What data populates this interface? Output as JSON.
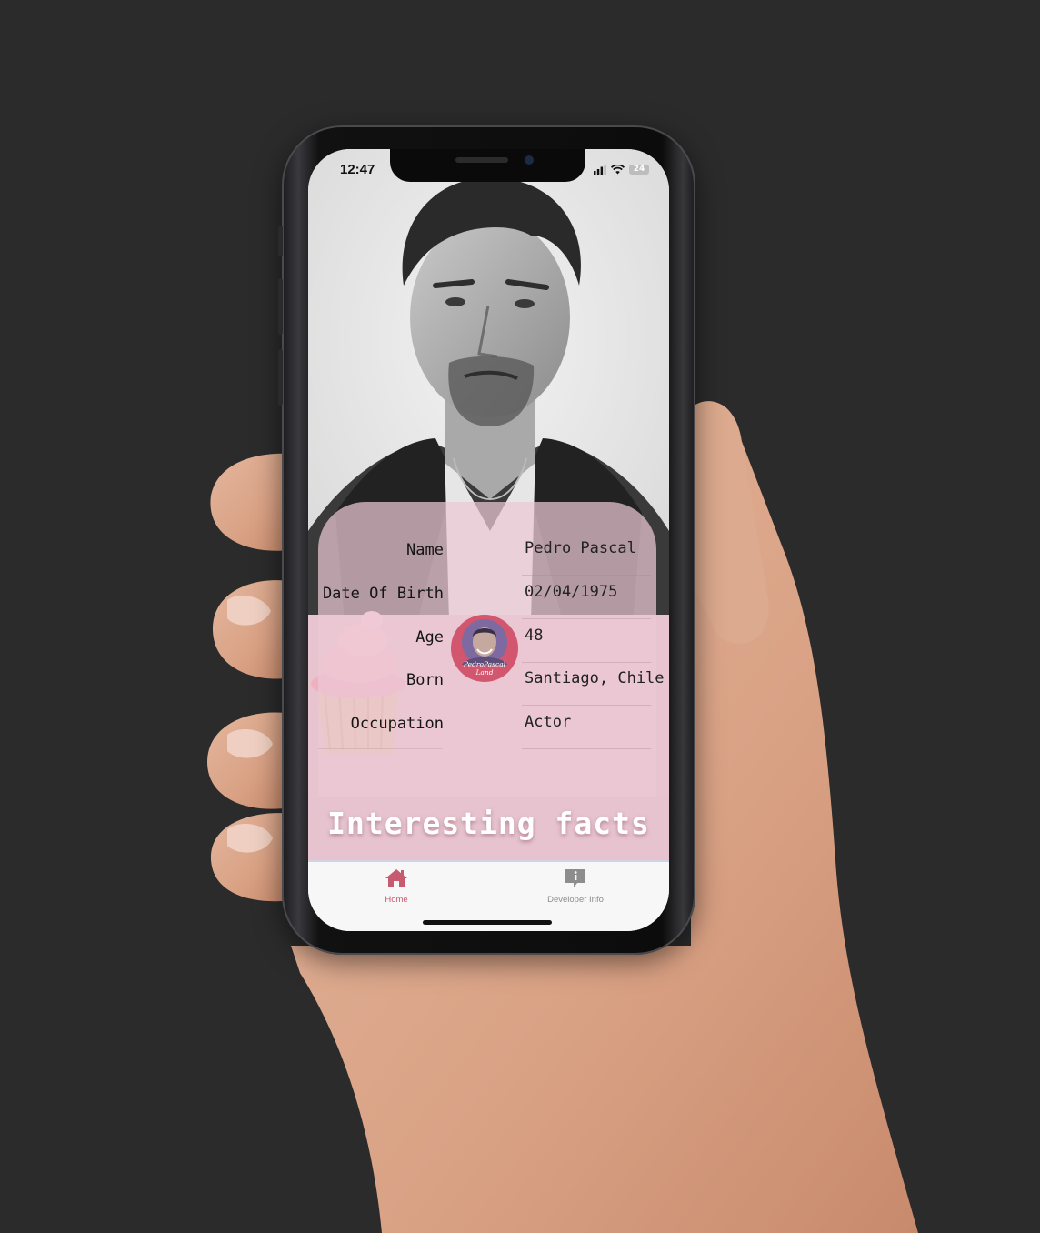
{
  "status_bar": {
    "time": "12:47",
    "battery": "24"
  },
  "profile": {
    "rows": [
      {
        "label": "Name",
        "value": "Pedro Pascal"
      },
      {
        "label": "Date Of Birth",
        "value": "02/04/1975"
      },
      {
        "label": "Age",
        "value": "48"
      },
      {
        "label": "Born",
        "value": "Santiago, Chile"
      },
      {
        "label": "Occupation",
        "value": "Actor"
      }
    ]
  },
  "logo": {
    "line1": "PedroPascal",
    "line2": "Land"
  },
  "section": {
    "title": "Interesting facts"
  },
  "tabbar": {
    "home_label": "Home",
    "dev_label": "Developer Info"
  },
  "colors": {
    "accent": "#c85a70",
    "card_pink": "#ecc8d4",
    "background": "#2b2b2b"
  }
}
